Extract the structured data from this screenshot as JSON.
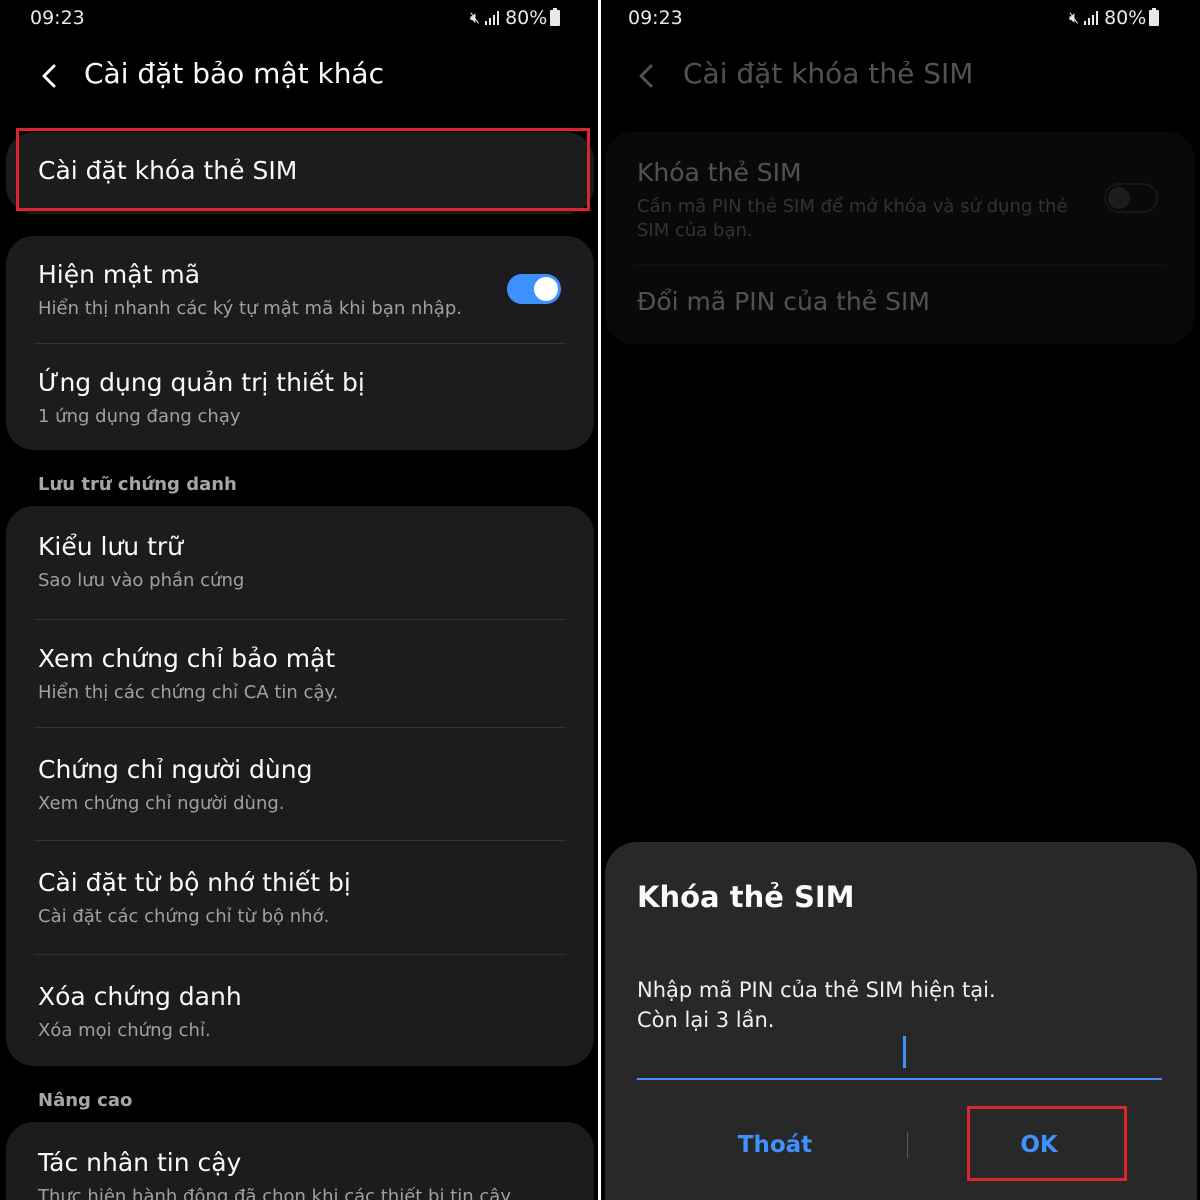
{
  "left": {
    "status": {
      "time": "09:23",
      "battery": "80%"
    },
    "title": "Cài đặt bảo mật khác",
    "sim_lock_item": "Cài đặt khóa thẻ SIM",
    "group1": [
      {
        "title": "Hiện mật mã",
        "subtitle": "Hiển thị nhanh các ký tự mật mã khi bạn nhập.",
        "toggle_on": true
      },
      {
        "title": "Ứng dụng quản trị thiết bị",
        "subtitle": "1 ứng dụng đang chạy"
      }
    ],
    "section_credentials": "Lưu trữ chứng danh",
    "group2": [
      {
        "title": "Kiểu lưu trữ",
        "subtitle": "Sao lưu vào phần cứng"
      },
      {
        "title": "Xem chứng chỉ bảo mật",
        "subtitle": "Hiển thị các chứng chỉ CA tin cậy."
      },
      {
        "title": "Chứng chỉ người dùng",
        "subtitle": "Xem chứng chỉ người dùng."
      },
      {
        "title": "Cài đặt từ bộ nhớ thiết bị",
        "subtitle": "Cài đặt các chứng chỉ từ bộ nhớ."
      },
      {
        "title": "Xóa chứng danh",
        "subtitle": "Xóa mọi chứng chỉ."
      }
    ],
    "section_advanced": "Nâng cao",
    "group3": [
      {
        "title": "Tác nhân tin cậy",
        "subtitle": "Thực hiện hành động đã chọn khi các thiết bị tin cậy"
      }
    ]
  },
  "right": {
    "status": {
      "time": "09:23",
      "battery": "80%"
    },
    "title": "Cài đặt khóa thẻ SIM",
    "lock_item": {
      "title": "Khóa thẻ SIM",
      "subtitle_line1": "Cần mã PIN thẻ SIM để mở khóa và sử dụng thẻ",
      "subtitle_line2": "SIM của bạn.",
      "toggle_on": false
    },
    "change_pin_item": "Đổi mã PIN của thẻ SIM",
    "dialog": {
      "title": "Khóa thẻ SIM",
      "message_line1": "Nhập mã PIN của thẻ SIM hiện tại.",
      "message_line2": "Còn lại 3 lần.",
      "pin_value": "",
      "cancel_label": "Thoát",
      "ok_label": "OK"
    }
  },
  "colors": {
    "background": "#000000",
    "card": "#1c1c1e",
    "dialog": "#282828",
    "accent": "#3e91ff",
    "highlight": "#d9262c"
  },
  "icons": [
    "back-arrow-icon",
    "mute-icon",
    "signal-icon",
    "battery-icon"
  ]
}
